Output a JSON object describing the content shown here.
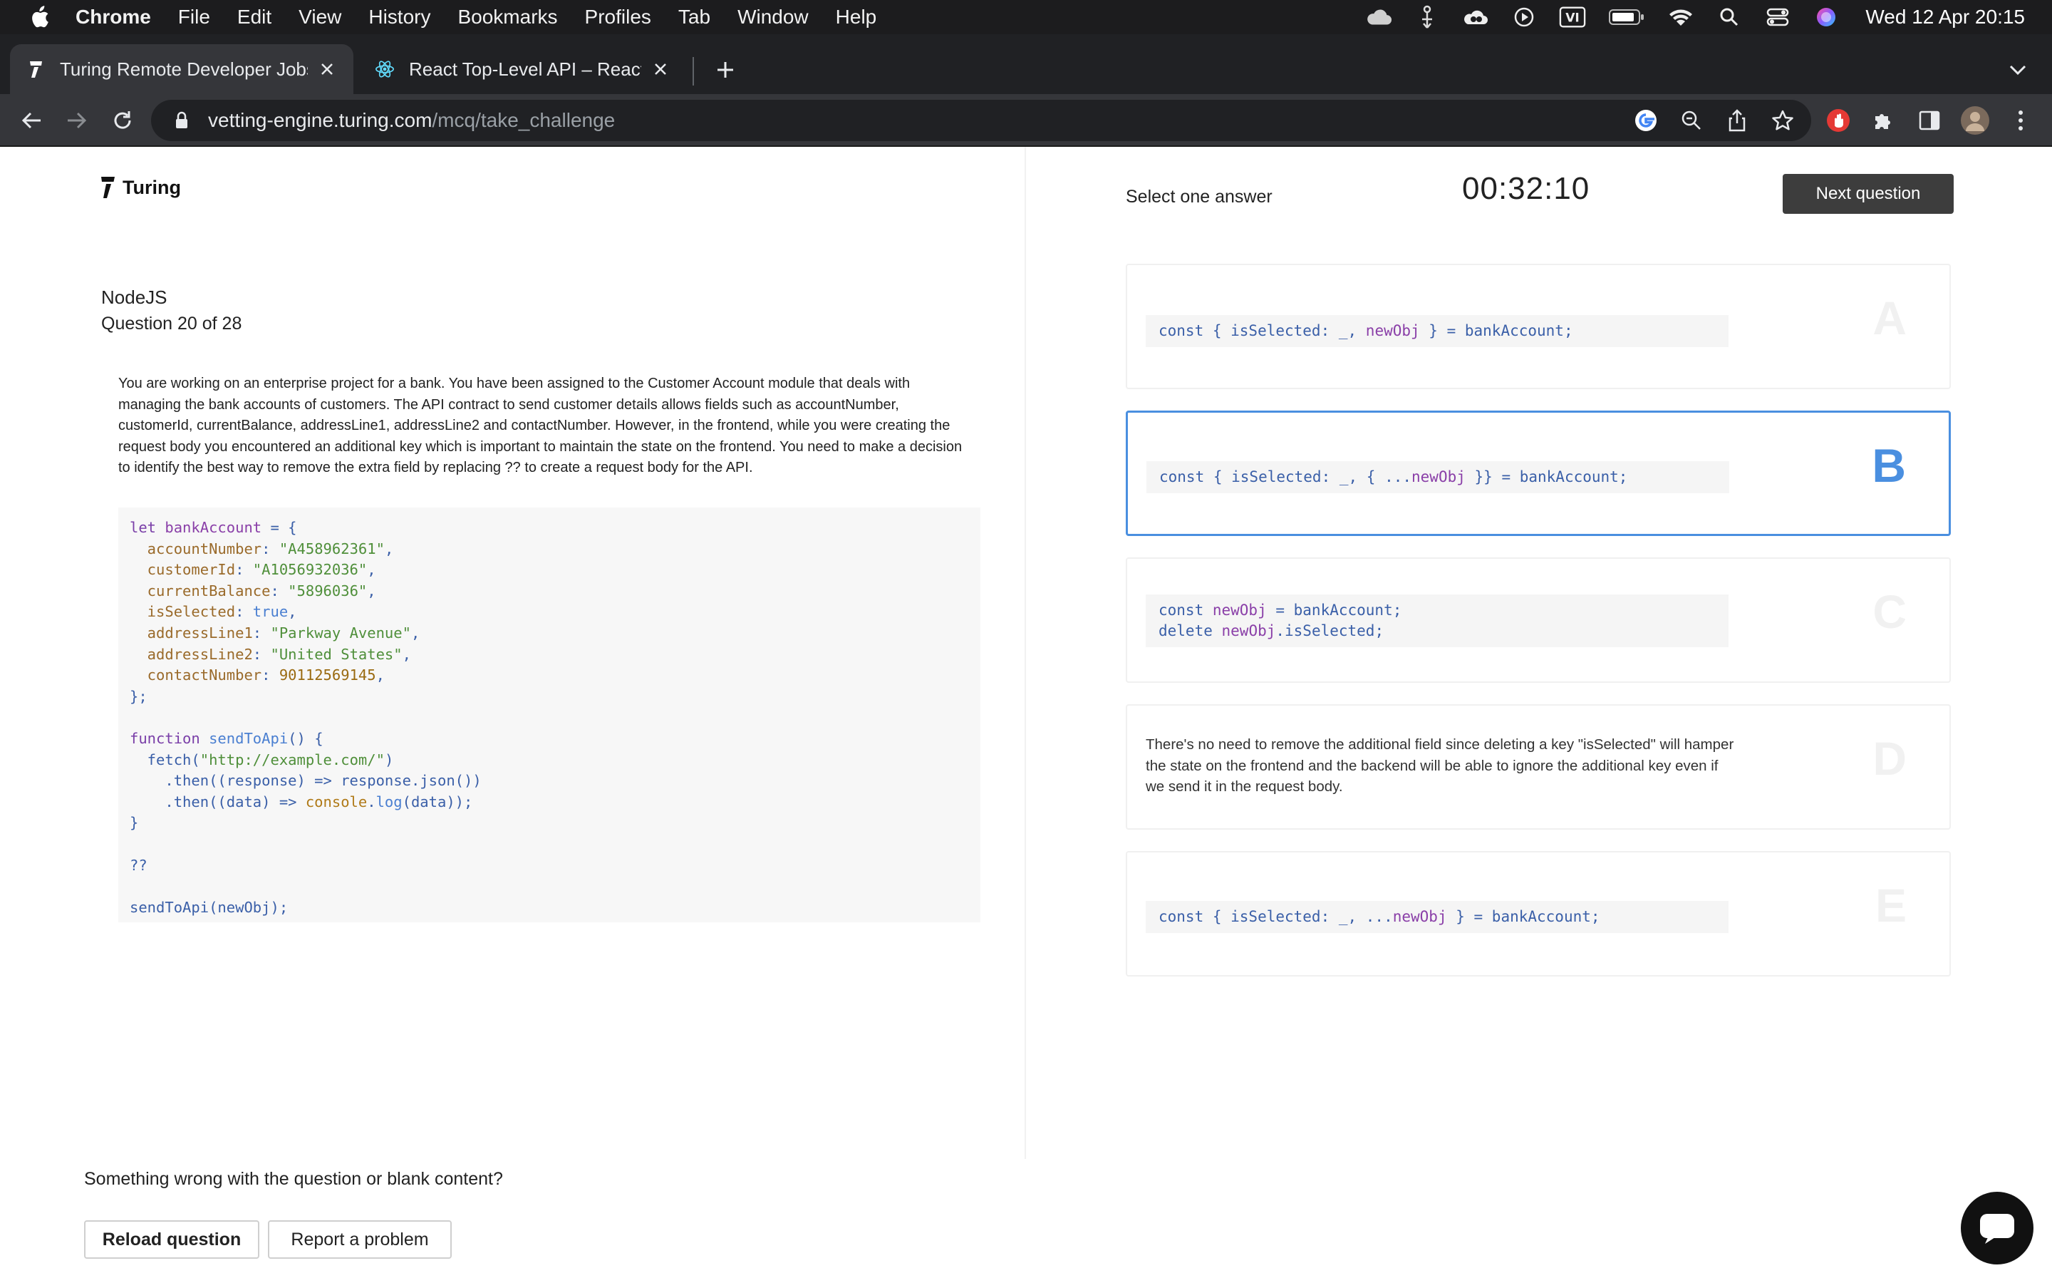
{
  "menubar": {
    "app_name": "Chrome",
    "items": [
      "File",
      "Edit",
      "View",
      "History",
      "Bookmarks",
      "Profiles",
      "Tab",
      "Window",
      "Help"
    ],
    "status_icons": [
      "cloud-icon",
      "accessibility-icon",
      "creative-cloud-icon",
      "play-icon",
      "vi-input-icon",
      "battery-icon",
      "wifi-icon",
      "spotlight-icon",
      "control-center-icon",
      "siri-icon"
    ],
    "vi_label": "VI",
    "clock": "Wed 12 Apr  20:15"
  },
  "tabs": [
    {
      "title": "Turing Remote Developer Jobs",
      "favicon": "turing-icon",
      "active": true
    },
    {
      "title": "React Top-Level API – React",
      "favicon": "react-icon",
      "active": false
    }
  ],
  "address_bar": {
    "domain": "vetting-engine.turing.com",
    "path": "/mcq/take_challenge"
  },
  "brand": {
    "name": "Turing",
    "accent_color": "#4a8fe0",
    "button_color": "#3d3d3d"
  },
  "question": {
    "topic": "NodeJS",
    "progress": "Question 20 of 28",
    "text": "You are working on an enterprise project for a bank. You have been assigned to the Customer Account module that deals with managing the bank accounts of customers. The API contract to send customer details allows fields such as accountNumber, customerId, currentBalance, addressLine1, addressLine2 and contactNumber. However, in the frontend, while you were creating the request body you encountered an additional key which is important to maintain the state on the frontend. You need to make a decision to identify the best way to remove the extra field by replacing ?? to create a request body for the API.",
    "code": {
      "l01_kw": "let",
      "l01_var": " bankAccount",
      "l01_rest": " = {",
      "l02_prop": "  accountNumber",
      "l02_p": ": ",
      "l02_str": "\"A458962361\"",
      "l02_end": ",",
      "l03_prop": "  customerId",
      "l03_p": ": ",
      "l03_str": "\"A1056932036\"",
      "l03_end": ",",
      "l04_prop": "  currentBalance",
      "l04_p": ": ",
      "l04_str": "\"5896036\"",
      "l04_end": ",",
      "l05_prop": "  isSelected",
      "l05_p": ": ",
      "l05_bool": "true",
      "l05_end": ",",
      "l06_prop": "  addressLine1",
      "l06_p": ": ",
      "l06_str": "\"Parkway Avenue\"",
      "l06_end": ",",
      "l07_prop": "  addressLine2",
      "l07_p": ": ",
      "l07_str": "\"United States\"",
      "l07_end": ",",
      "l08_prop": "  contactNumber",
      "l08_p": ": ",
      "l08_num": "90112569145",
      "l08_end": ",",
      "l09": "};",
      "l11_kw": "function",
      "l11_fn": " sendToApi",
      "l11_rest": "() {",
      "l12_a": "  fetch(",
      "l12_str": "\"http://example.com/\"",
      "l12_b": ")",
      "l13": "    .then((response) => response.json())",
      "l14_a": "    .then((data) => ",
      "l14_obj": "console",
      "l14_b": ".",
      "l14_fn": "log",
      "l14_c": "(data));",
      "l15": "}",
      "l17": "??",
      "l19": "sendToApi(newObj);"
    }
  },
  "answers": {
    "instruction": "Select one answer",
    "timer": "00:32:10",
    "next_label": "Next question",
    "selected": "B",
    "options": [
      {
        "letter": "A",
        "c1": "const { isSelected: _, ",
        "v1": "newObj",
        "c2": " } = bankAccount;"
      },
      {
        "letter": "B",
        "c1": "const { isSelected: _, { ...",
        "v1": "newObj",
        "c2": " }} = bankAccount;"
      },
      {
        "letter": "C",
        "c1": "const ",
        "v1": "newObj",
        "c2": " = bankAccount;",
        "c3": "delete ",
        "v2": "newObj",
        "c4": ".isSelected;"
      },
      {
        "letter": "D",
        "text": "There's no need to remove the additional field since deleting a key \"isSelected\" will hamper the state on the frontend and the backend will be able to ignore the additional key even if we send it in the request body."
      },
      {
        "letter": "E",
        "c1": "const { isSelected: _, ...",
        "v1": "newObj",
        "c2": " } = bankAccount;"
      }
    ]
  },
  "footer": {
    "prompt": "Something wrong with the question or blank content?",
    "reload_label": "Reload question",
    "report_label": "Report a problem"
  }
}
